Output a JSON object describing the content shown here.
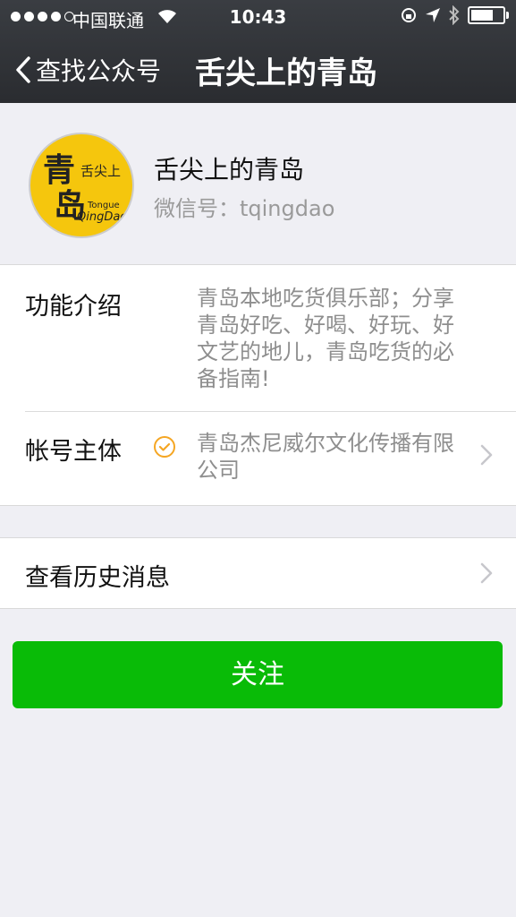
{
  "status_bar": {
    "carrier": "中国联通",
    "time": "10:43",
    "battery_level": 0.8
  },
  "nav": {
    "back_label": "查找公众号",
    "title": "舌尖上的青岛"
  },
  "profile": {
    "name": "舌尖上的青岛",
    "wechat_id": "微信号：tqingdao",
    "avatar": {
      "big_text": "青岛",
      "small_text": "舌尖上",
      "english_line1": "Tongue",
      "english_line2": "QingDao"
    }
  },
  "info": {
    "intro_label": "功能介绍",
    "intro_lines": [
      "青岛本地吃货俱乐部；分享",
      "青岛好吃、好喝、好玩、好",
      "文艺的地儿，青岛吃货的必",
      "备指南!"
    ],
    "owner_label": "帐号主体",
    "owner_lines": [
      "青岛杰尼威尔文化传播有限",
      "公司"
    ]
  },
  "history": {
    "label": "查看历史消息"
  },
  "follow_button": {
    "label": "关注"
  },
  "colors": {
    "nav_bg": "#2f3135",
    "page_bg": "#efeff4",
    "follow_green": "#09bb07",
    "verified_orange": "#f5a623",
    "avatar_yellow": "#f5c60d"
  }
}
